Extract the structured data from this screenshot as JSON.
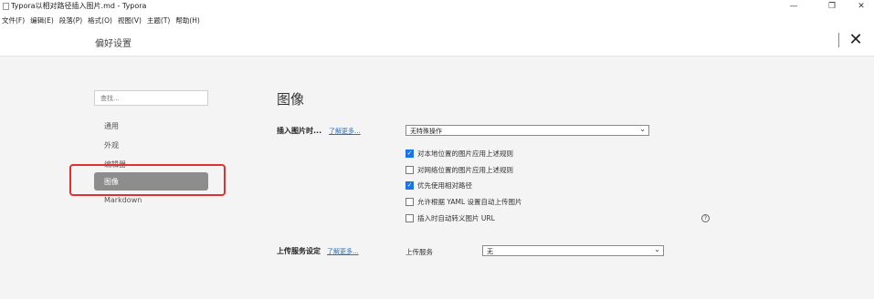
{
  "window": {
    "title": "Typora以相对路径插入图片.md - Typora",
    "min_icon": "minimize-icon",
    "max_icon": "maximize-icon",
    "close_icon": "close-icon"
  },
  "menu": [
    "文件(F)",
    "编辑(E)",
    "段落(P)",
    "格式(O)",
    "视图(V)",
    "主题(T)",
    "帮助(H)"
  ],
  "prefs": {
    "title": "偏好设置",
    "search_placeholder": "查找...",
    "nav": [
      {
        "label": "通用",
        "active": false
      },
      {
        "label": "外观",
        "active": false
      },
      {
        "label": "编辑器",
        "active": false
      },
      {
        "label": "图像",
        "active": true
      },
      {
        "label": "Markdown",
        "active": false
      }
    ]
  },
  "image_section": {
    "title": "图像",
    "insert_label": "插入图片时...",
    "learn_more": "了解更多...",
    "insert_action": "无特殊操作",
    "options": [
      {
        "label": "对本地位置的图片应用上述规则",
        "checked": true
      },
      {
        "label": "对网络位置的图片应用上述规则",
        "checked": false
      },
      {
        "label": "优先使用相对路径",
        "checked": true
      },
      {
        "label": "允许根据 YAML 设置自动上传图片",
        "checked": false
      },
      {
        "label": "插入时自动转义图片 URL",
        "checked": false
      }
    ],
    "upload_label": "上传服务设定",
    "upload_learn_more": "了解更多...",
    "upload_service_label": "上传服务",
    "upload_service_value": "无"
  },
  "colors": {
    "accent": "#1a73e8",
    "active_nav": "#8d8d8d",
    "highlight": "#e03030",
    "link": "#2f6fbf"
  }
}
